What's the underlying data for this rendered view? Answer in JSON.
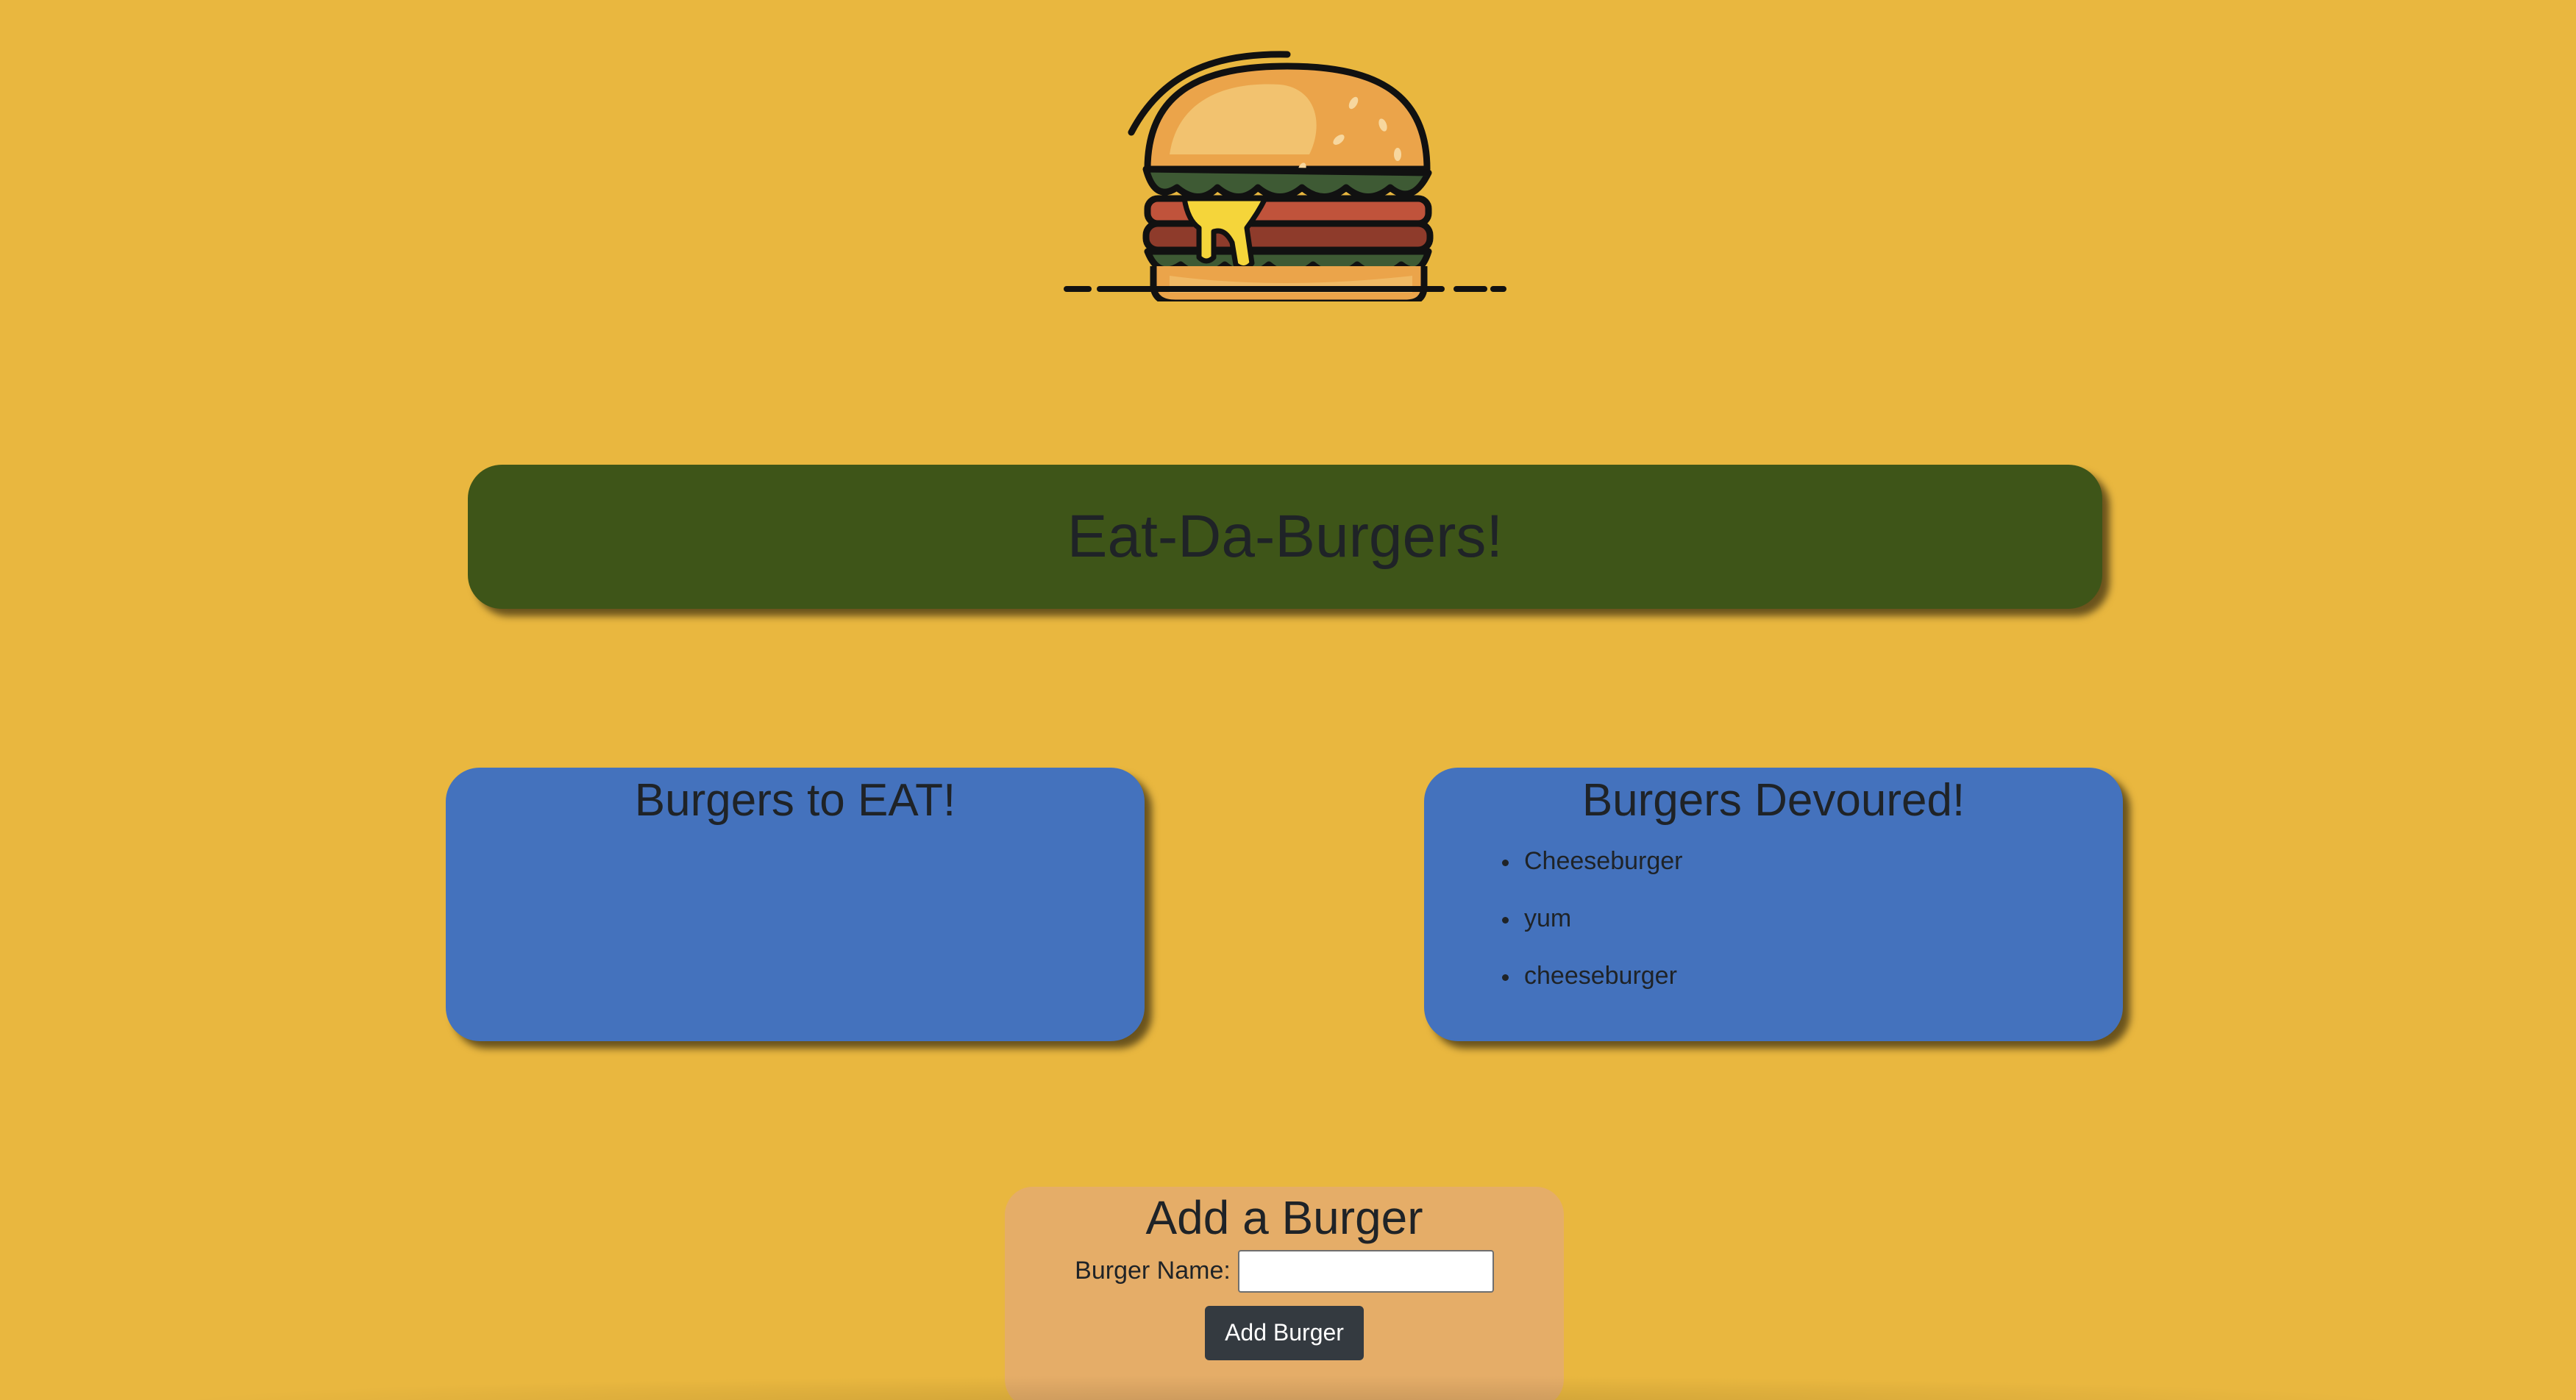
{
  "logo": {
    "icon": "burger-icon"
  },
  "header": {
    "title": "Eat-Da-Burgers!"
  },
  "to_eat": {
    "title": "Burgers to EAT!",
    "items": []
  },
  "devoured": {
    "title": "Burgers Devoured!",
    "items": [
      "Cheeseburger",
      "yum",
      "cheeseburger"
    ]
  },
  "add_form": {
    "title": "Add a Burger",
    "label": "Burger Name:",
    "value": "",
    "button": "Add Burger"
  },
  "colors": {
    "background": "#E9B73F",
    "header_bg": "#3E5518",
    "card_bg": "#4472BD",
    "form_bg": "#E5AD68",
    "button_bg": "#343a40"
  }
}
